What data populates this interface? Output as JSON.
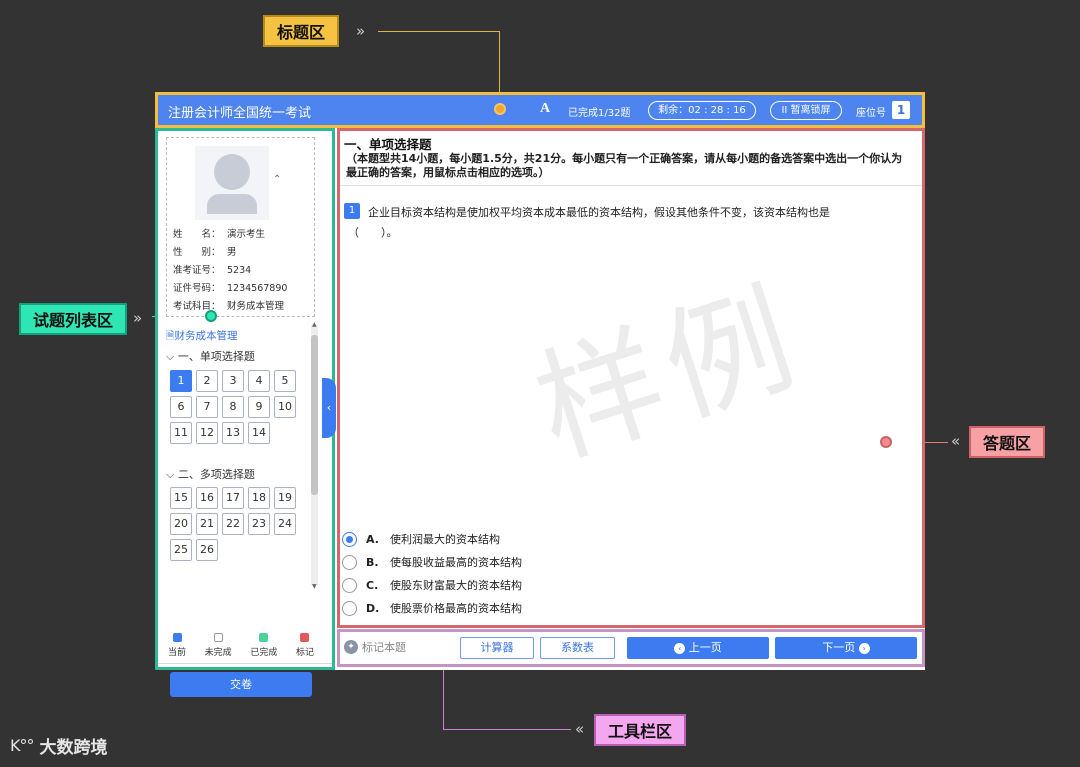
{
  "callouts": {
    "title_area": "标题区",
    "question_list_area": "试题列表区",
    "answer_area": "答题区",
    "toolbar_area": "工具栏区"
  },
  "header": {
    "app_title": "注册会计师全国统一考试",
    "font_icon": "A",
    "progress": "已完成1/32题",
    "timer": "剩余：02 : 28 : 16",
    "pause_button": "II 暂离锁屏",
    "seat_label": "座位号",
    "seat_number": "1"
  },
  "candidate": {
    "rows": [
      {
        "label": "姓　　名：",
        "value": "演示考生"
      },
      {
        "label": "性　　别：",
        "value": "男"
      },
      {
        "label": "准考证号：",
        "value": "5234"
      },
      {
        "label": "证件号码：",
        "value": "1234567890"
      },
      {
        "label": "考试科目：",
        "value": "财务成本管理"
      }
    ]
  },
  "question_list": {
    "subject": "财务成本管理",
    "sections": [
      {
        "title": "一、单项选择题",
        "numbers": [
          "1",
          "2",
          "3",
          "4",
          "5",
          "6",
          "7",
          "8",
          "9",
          "10",
          "11",
          "12",
          "13",
          "14"
        ]
      },
      {
        "title": "二、多项选择题",
        "numbers": [
          "15",
          "16",
          "17",
          "18",
          "19",
          "20",
          "21",
          "22",
          "23",
          "24",
          "25",
          "26"
        ]
      }
    ],
    "current": "1",
    "legend": [
      {
        "label": "当前",
        "color": "#3d7bf0"
      },
      {
        "label": "未完成",
        "color": "#ffffff"
      },
      {
        "label": "已完成",
        "color": "#4cd39a"
      },
      {
        "label": "标记",
        "color": "#e05a5a"
      }
    ],
    "submit": "交卷"
  },
  "question": {
    "section_title": "一、单项选择题",
    "section_desc": "（本题型共14小题，每小题1.5分，共21分。每小题只有一个正确答案，请从每小题的备选答案中选出一个你认为最正确的答案，用鼠标点击相应的选项。）",
    "number": "1",
    "text": "企业目标资本结构是使加权平均资本成本最低的资本结构，假设其他条件不变，该资本结构也是",
    "blank": "（　　）。",
    "watermark": "样例",
    "options": [
      {
        "letter": "A.",
        "text": "使利润最大的资本结构",
        "selected": true
      },
      {
        "letter": "B.",
        "text": "使每股收益最高的资本结构",
        "selected": false
      },
      {
        "letter": "C.",
        "text": "使股东财富最大的资本结构",
        "selected": false
      },
      {
        "letter": "D.",
        "text": "使股票价格最高的资本结构",
        "selected": false
      }
    ]
  },
  "toolbar": {
    "mark": "标记本题",
    "calculator": "计算器",
    "coef_table": "系数表",
    "prev": "上一页",
    "next": "下一页"
  },
  "brand": {
    "mark": "K°°",
    "name": "大数跨境"
  }
}
